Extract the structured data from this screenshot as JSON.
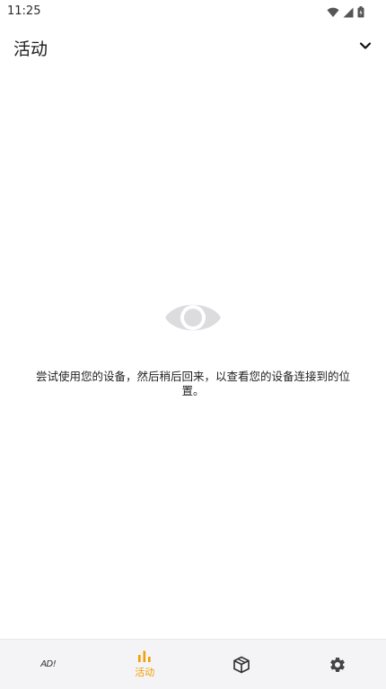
{
  "status_bar": {
    "time": "11:25",
    "icons": [
      "wifi-icon",
      "signal-icon",
      "battery-icon"
    ]
  },
  "header": {
    "title": "活动",
    "dropdown_icon": "chevron-down-icon"
  },
  "empty_state": {
    "icon": "eye-icon",
    "message": "尝试使用您的设备，然后稍后回来，以查看您的设备连接到的位置。"
  },
  "bottom_nav": {
    "items": [
      {
        "icon": "ad-icon",
        "icon_text": "AD!",
        "label": ""
      },
      {
        "icon": "bar-chart-icon",
        "label": "活动",
        "active": true
      },
      {
        "icon": "package-icon",
        "label": ""
      },
      {
        "icon": "gear-icon",
        "label": ""
      }
    ]
  },
  "colors": {
    "accent": "#f0a000",
    "icon_gray": "#dcdcdf",
    "nav_background": "#f4f4f7"
  }
}
